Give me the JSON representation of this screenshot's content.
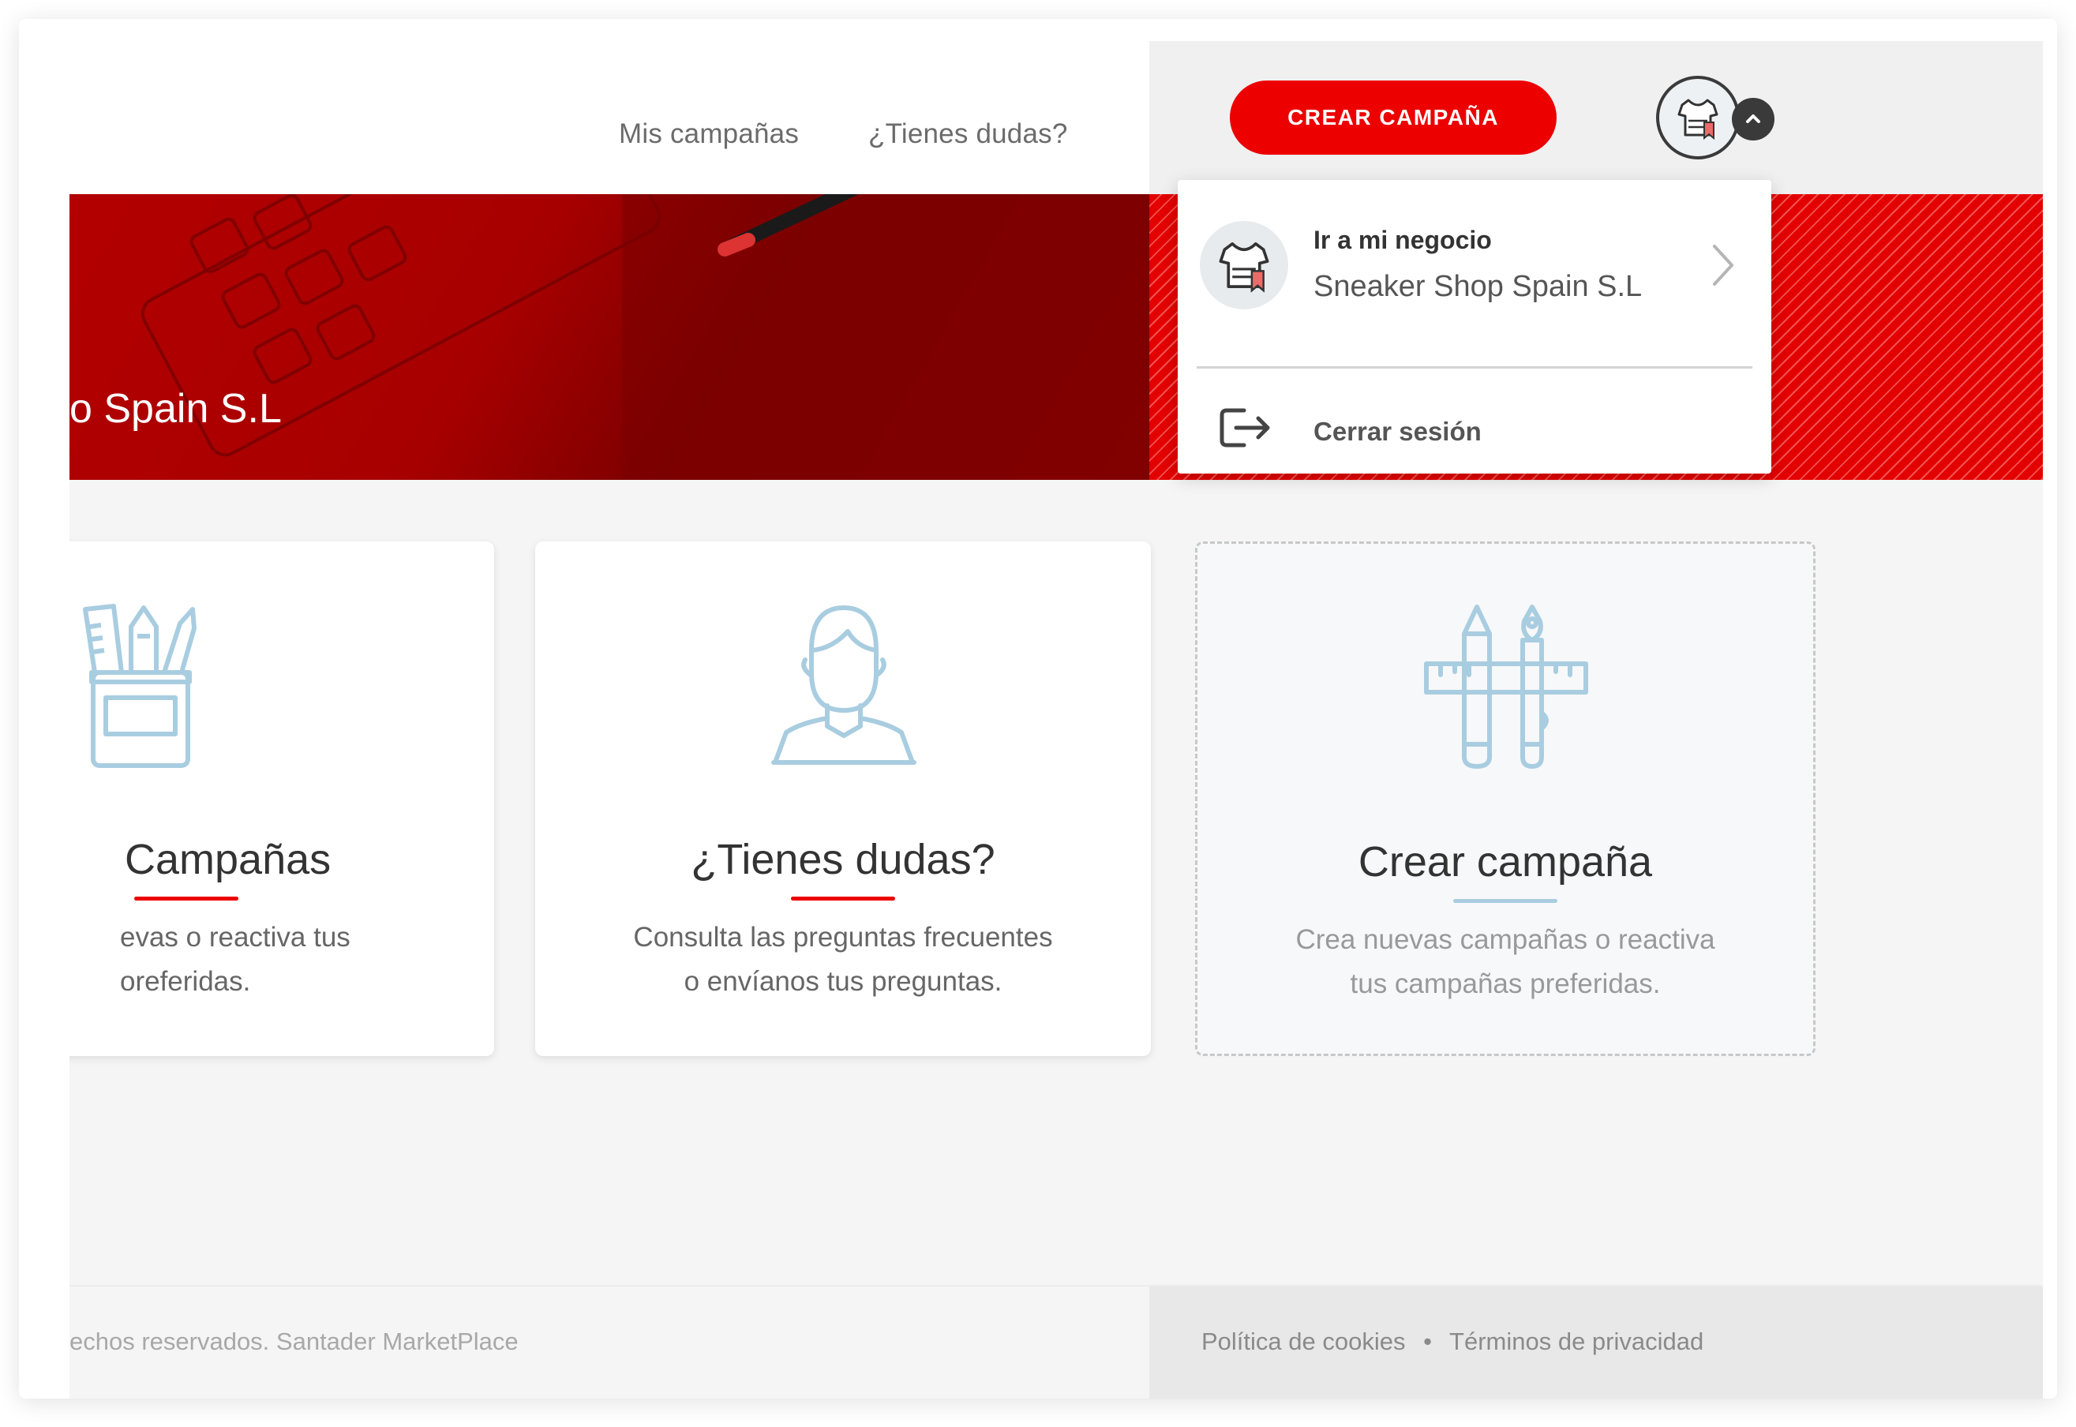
{
  "nav": {
    "my_campaigns": "Mis campañas",
    "questions": "¿Tienes dudas?",
    "create_button": "CREAR CAMPAÑA"
  },
  "banner": {
    "business_name_partial": "o Spain S.L"
  },
  "cards": [
    {
      "title": "Campañas",
      "desc_line1": "evas o reactiva tus",
      "desc_line2": "oreferidas.",
      "icon": "pencil-cup-icon"
    },
    {
      "title": "¿Tienes dudas?",
      "desc_line1": "Consulta las preguntas frecuentes",
      "desc_line2": "o envíanos tus preguntas.",
      "icon": "person-icon"
    },
    {
      "title": "Crear campaña",
      "desc_line1": "Crea nuevas campañas o reactiva",
      "desc_line2": "tus campañas preferidas.",
      "icon": "design-tools-icon"
    }
  ],
  "dropdown": {
    "business_label": "Ir a mi negocio",
    "business_name": "Sneaker Shop Spain S.L",
    "logout_label": "Cerrar sesión"
  },
  "footer": {
    "copyright_partial": "echos reservados. Santader MarketPlace",
    "cookies": "Política de cookies",
    "separator": "•",
    "privacy": "Términos de privacidad"
  },
  "colors": {
    "brand_red": "#ec0000",
    "icon_blue": "#a9cde0",
    "dark": "#3a3a3a"
  }
}
